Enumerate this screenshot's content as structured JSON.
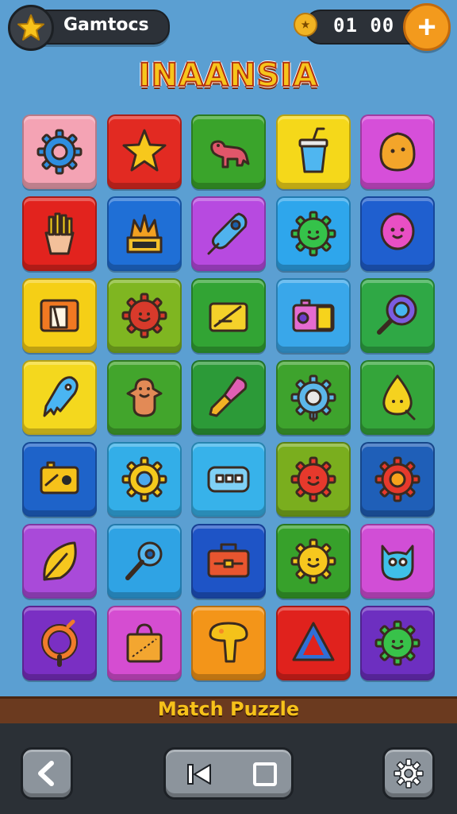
{
  "header": {
    "profile_label": "Gamtocs",
    "timer": "01 00",
    "title": "INAANSIA"
  },
  "footer": {
    "banner_label": "Match Puzzle"
  },
  "icons": {
    "back": "back-arrow-icon",
    "prev": "skip-back-icon",
    "stop": "stop-icon",
    "settings": "gear-icon"
  },
  "tiles": [
    {
      "row": 0,
      "col": 0,
      "color": "#f4a3b4",
      "icon": "gear"
    },
    {
      "row": 0,
      "col": 1,
      "color": "#e22a22",
      "icon": "star"
    },
    {
      "row": 0,
      "col": 2,
      "color": "#3aa42b",
      "icon": "dinosaur"
    },
    {
      "row": 0,
      "col": 3,
      "color": "#f5d81a",
      "icon": "cup"
    },
    {
      "row": 0,
      "col": 4,
      "color": "#d64fd9",
      "icon": "blob"
    },
    {
      "row": 1,
      "col": 0,
      "color": "#e2231e",
      "icon": "fries"
    },
    {
      "row": 1,
      "col": 1,
      "color": "#1f6fd6",
      "icon": "crown-box"
    },
    {
      "row": 1,
      "col": 2,
      "color": "#b74ae0",
      "icon": "popsicle"
    },
    {
      "row": 1,
      "col": 3,
      "color": "#2ea6ec",
      "icon": "green-gear"
    },
    {
      "row": 1,
      "col": 4,
      "color": "#1f5fcf",
      "icon": "balloon"
    },
    {
      "row": 2,
      "col": 0,
      "color": "#f5cf16",
      "icon": "folder"
    },
    {
      "row": 2,
      "col": 1,
      "color": "#7fb621",
      "icon": "red-gear"
    },
    {
      "row": 2,
      "col": 2,
      "color": "#32a434",
      "icon": "pencil-box"
    },
    {
      "row": 2,
      "col": 3,
      "color": "#39a7ea",
      "icon": "camera"
    },
    {
      "row": 2,
      "col": 4,
      "color": "#2fa845",
      "icon": "magnifier"
    },
    {
      "row": 3,
      "col": 0,
      "color": "#f4d81e",
      "icon": "ghost"
    },
    {
      "row": 3,
      "col": 1,
      "color": "#42a52c",
      "icon": "creature"
    },
    {
      "row": 3,
      "col": 2,
      "color": "#2c9a38",
      "icon": "paintbrush"
    },
    {
      "row": 3,
      "col": 3,
      "color": "#3ea32d",
      "icon": "cog-pin"
    },
    {
      "row": 3,
      "col": 4,
      "color": "#34a53a",
      "icon": "drop"
    },
    {
      "row": 4,
      "col": 0,
      "color": "#1e63c9",
      "icon": "radio"
    },
    {
      "row": 4,
      "col": 1,
      "color": "#33aee8",
      "icon": "sun-gear"
    },
    {
      "row": 4,
      "col": 2,
      "color": "#37b2ea",
      "icon": "remote"
    },
    {
      "row": 4,
      "col": 3,
      "color": "#7aae1e",
      "icon": "smile-gear"
    },
    {
      "row": 4,
      "col": 4,
      "color": "#1f5fb8",
      "icon": "orange-gear"
    },
    {
      "row": 5,
      "col": 0,
      "color": "#a94ad9",
      "icon": "leaf"
    },
    {
      "row": 5,
      "col": 1,
      "color": "#2fa3e4",
      "icon": "key"
    },
    {
      "row": 5,
      "col": 2,
      "color": "#1e54c6",
      "icon": "toolbox"
    },
    {
      "row": 5,
      "col": 3,
      "color": "#37a12b",
      "icon": "sun-face"
    },
    {
      "row": 5,
      "col": 4,
      "color": "#d14ed6",
      "icon": "cat-face"
    },
    {
      "row": 6,
      "col": 0,
      "color": "#7a2fc3",
      "icon": "ring"
    },
    {
      "row": 6,
      "col": 1,
      "color": "#d54dd1",
      "icon": "bag"
    },
    {
      "row": 6,
      "col": 2,
      "color": "#f39519",
      "icon": "mushroom"
    },
    {
      "row": 6,
      "col": 3,
      "color": "#e0221d",
      "icon": "triangle"
    },
    {
      "row": 6,
      "col": 4,
      "color": "#6d2fc0",
      "icon": "green-blob"
    }
  ]
}
